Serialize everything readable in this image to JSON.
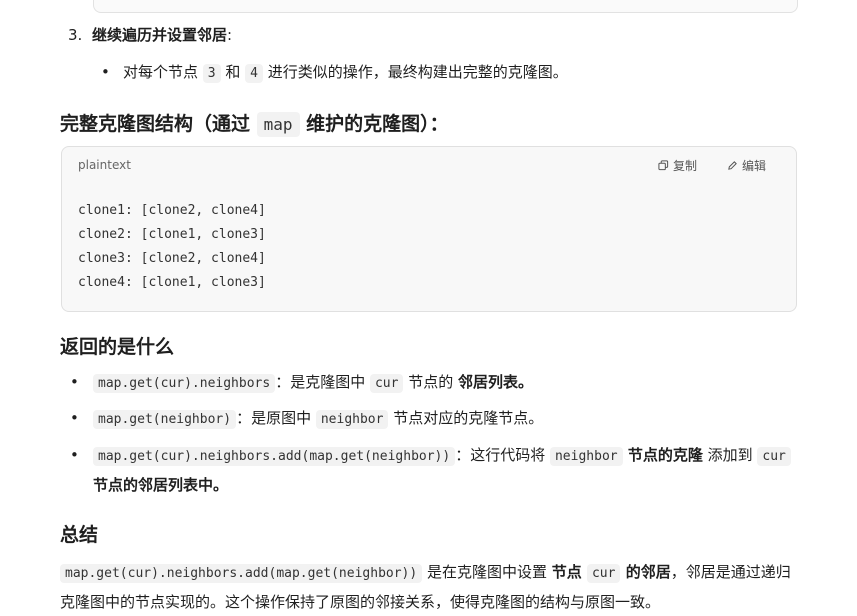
{
  "step3": {
    "number": "3.",
    "title": "继续遍历并设置邻居",
    "colon": ":",
    "sub_text_1": "对每个节点 ",
    "node_3": "3",
    "sub_and": " 和 ",
    "node_4": "4",
    "sub_text_2": " 进行类似的操作，最终构建出完整的克隆图。"
  },
  "structure_heading": {
    "part1": "完整克隆图结构（通过 ",
    "code": "map",
    "part2": " 维护的克隆图）："
  },
  "code_block": {
    "language": "plaintext",
    "copy_label": "复制",
    "edit_label": "编辑",
    "lines": [
      "clone1: [clone2, clone4]",
      "clone2: [clone1, clone3]",
      "clone3: [clone2, clone4]",
      "clone4: [clone1, clone3]"
    ]
  },
  "return_heading": "返回的是什么",
  "bullets": {
    "b1_code": "map.get(cur).neighbors",
    "b1_t1": "：是克隆图中 ",
    "b1_code2": "cur",
    "b1_t2": " 节点的 ",
    "b1_bold": "邻居列表。",
    "b2_code": "map.get(neighbor)",
    "b2_t1": "：是原图中 ",
    "b2_code2": "neighbor",
    "b2_t2": " 节点对应的克隆节点。",
    "b3_code": "map.get(cur).neighbors.add(map.get(neighbor))",
    "b3_t1": "：这行代码将 ",
    "b3_code2": "neighbor",
    "b3_bold1": " 节点的克隆",
    "b3_t2": " 添加到 ",
    "b3_code3": "cur",
    "b3_bold2": "节点的邻居列表中。"
  },
  "summary_heading": "总结",
  "summary": {
    "code": "map.get(cur).neighbors.add(map.get(neighbor))",
    "t1": " 是在克隆图中设置 ",
    "bold1": "节点 ",
    "code2": "cur",
    "bold2": " 的邻居",
    "t2": "，邻居是通过递归克隆图中的节点实现的。这个操作保持了原图的邻接关系，使得克隆图的结构与原图一致。"
  }
}
